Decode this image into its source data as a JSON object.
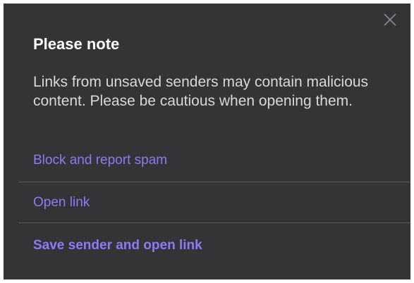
{
  "dialog": {
    "title": "Please note",
    "message": "Links from unsaved senders may contain malicious content. Please be cautious when opening them.",
    "close_icon": "close-icon",
    "actions": [
      {
        "label": "Block and report spam",
        "emphasis": false
      },
      {
        "label": "Open link",
        "emphasis": false
      },
      {
        "label": "Save sender and open link",
        "emphasis": true
      }
    ]
  },
  "colors": {
    "background": "#323436",
    "accent": "#8b7cf6",
    "text": "#ffffff",
    "divider": "#5a5c5f"
  }
}
